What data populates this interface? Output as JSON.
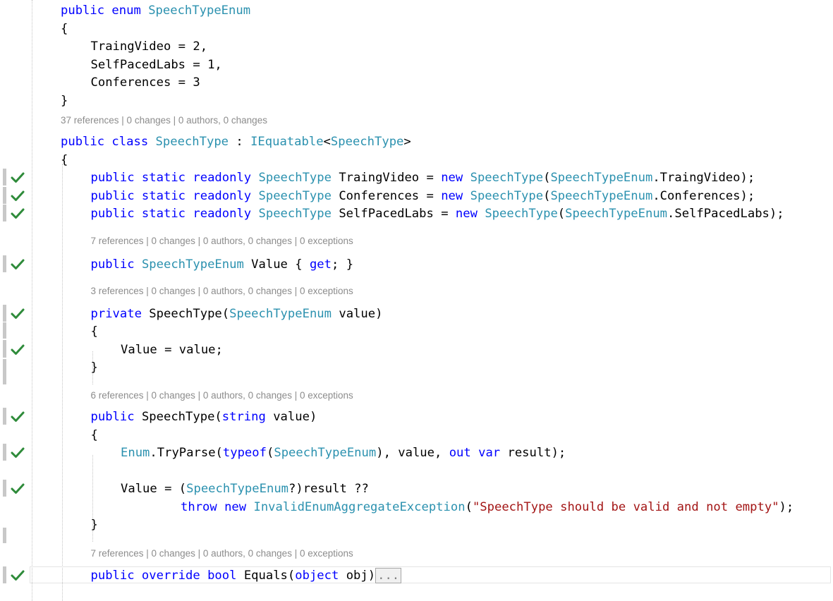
{
  "colors": {
    "keyword": "#0000ff",
    "type": "#2b91af",
    "string": "#a31515",
    "text": "#000000",
    "codelens": "#8c8c8c",
    "check": "#2e8b3a",
    "gutter_bar": "#c8c8c8"
  },
  "editor": {
    "lines": [
      {
        "kind": "code",
        "row": 0,
        "indent": 0,
        "check": false,
        "tokens": [
          [
            "kw",
            "public enum "
          ],
          [
            "ty",
            "SpeechTypeEnum"
          ]
        ]
      },
      {
        "kind": "code",
        "row": 1,
        "indent": 0,
        "check": false,
        "tokens": [
          [
            "tx",
            "{"
          ]
        ]
      },
      {
        "kind": "code",
        "row": 2,
        "indent": 1,
        "check": false,
        "tokens": [
          [
            "tx",
            "TraingVideo = 2,"
          ]
        ]
      },
      {
        "kind": "code",
        "row": 3,
        "indent": 1,
        "check": false,
        "tokens": [
          [
            "tx",
            "SelfPacedLabs = 1,"
          ]
        ]
      },
      {
        "kind": "code",
        "row": 4,
        "indent": 1,
        "check": false,
        "tokens": [
          [
            "tx",
            "Conferences = 3"
          ]
        ]
      },
      {
        "kind": "code",
        "row": 5,
        "indent": 0,
        "check": false,
        "tokens": [
          [
            "tx",
            "}"
          ]
        ]
      },
      {
        "kind": "lens",
        "row": 6.5,
        "indent": 0,
        "text": "37 references | 0 changes | 0 authors, 0 changes"
      },
      {
        "kind": "code",
        "row": 7.3,
        "indent": 0,
        "check": false,
        "tokens": [
          [
            "kw",
            "public class "
          ],
          [
            "ty",
            "SpeechType"
          ],
          [
            "tx",
            " : "
          ],
          [
            "ty",
            "IEquatable"
          ],
          [
            "tx",
            "<"
          ],
          [
            "ty",
            "SpeechType"
          ],
          [
            "tx",
            ">"
          ]
        ]
      },
      {
        "kind": "code",
        "row": 8.3,
        "indent": 0,
        "check": false,
        "tokens": [
          [
            "tx",
            "{"
          ]
        ]
      },
      {
        "kind": "code",
        "row": 9.3,
        "indent": 1,
        "check": true,
        "tokens": [
          [
            "kw",
            "public static readonly "
          ],
          [
            "ty",
            "SpeechType"
          ],
          [
            "tx",
            " TraingVideo = "
          ],
          [
            "kw",
            "new "
          ],
          [
            "ty",
            "SpeechType"
          ],
          [
            "tx",
            "("
          ],
          [
            "ty",
            "SpeechTypeEnum"
          ],
          [
            "tx",
            ".TraingVideo);"
          ]
        ]
      },
      {
        "kind": "code",
        "row": 10.3,
        "indent": 1,
        "check": true,
        "tokens": [
          [
            "kw",
            "public static readonly "
          ],
          [
            "ty",
            "SpeechType"
          ],
          [
            "tx",
            " Conferences = "
          ],
          [
            "kw",
            "new "
          ],
          [
            "ty",
            "SpeechType"
          ],
          [
            "tx",
            "("
          ],
          [
            "ty",
            "SpeechTypeEnum"
          ],
          [
            "tx",
            ".Conferences);"
          ]
        ]
      },
      {
        "kind": "code",
        "row": 11.3,
        "indent": 1,
        "check": true,
        "tokens": [
          [
            "kw",
            "public static readonly "
          ],
          [
            "ty",
            "SpeechType"
          ],
          [
            "tx",
            " SelfPacedLabs = "
          ],
          [
            "kw",
            "new "
          ],
          [
            "ty",
            "SpeechType"
          ],
          [
            "tx",
            "("
          ],
          [
            "ty",
            "SpeechTypeEnum"
          ],
          [
            "tx",
            ".SelfPacedLabs);"
          ]
        ]
      },
      {
        "kind": "lens",
        "row": 13.2,
        "indent": 1,
        "text": "7 references | 0 changes | 0 authors, 0 changes | 0 exceptions"
      },
      {
        "kind": "code",
        "row": 14.1,
        "indent": 1,
        "check": true,
        "tokens": [
          [
            "kw",
            "public "
          ],
          [
            "ty",
            "SpeechTypeEnum"
          ],
          [
            "tx",
            " Value { "
          ],
          [
            "kw",
            "get"
          ],
          [
            "tx",
            "; }"
          ]
        ]
      },
      {
        "kind": "lens",
        "row": 16.0,
        "indent": 1,
        "text": "3 references | 0 changes | 0 authors, 0 changes | 0 exceptions"
      },
      {
        "kind": "code",
        "row": 16.85,
        "indent": 1,
        "check": true,
        "tokens": [
          [
            "kw",
            "private "
          ],
          [
            "tx",
            "SpeechType("
          ],
          [
            "ty",
            "SpeechTypeEnum"
          ],
          [
            "tx",
            " value)"
          ]
        ]
      },
      {
        "kind": "code",
        "row": 17.85,
        "indent": 1,
        "check": false,
        "tokens": [
          [
            "tx",
            "{"
          ]
        ]
      },
      {
        "kind": "code",
        "row": 18.85,
        "indent": 2,
        "check": true,
        "tokens": [
          [
            "tx",
            "Value = value;"
          ]
        ]
      },
      {
        "kind": "code",
        "row": 19.85,
        "indent": 1,
        "check": false,
        "tokens": [
          [
            "tx",
            "}"
          ]
        ]
      },
      {
        "kind": "lens",
        "row": 21.8,
        "indent": 1,
        "text": "6 references | 0 changes | 0 authors, 0 changes | 0 exceptions"
      },
      {
        "kind": "code",
        "row": 22.6,
        "indent": 1,
        "check": true,
        "tokens": [
          [
            "kw",
            "public "
          ],
          [
            "tx",
            "SpeechType("
          ],
          [
            "kw",
            "string"
          ],
          [
            "tx",
            " value)"
          ]
        ]
      },
      {
        "kind": "code",
        "row": 23.6,
        "indent": 1,
        "check": false,
        "tokens": [
          [
            "tx",
            "{"
          ]
        ]
      },
      {
        "kind": "code",
        "row": 24.6,
        "indent": 2,
        "check": true,
        "tokens": [
          [
            "ty",
            "Enum"
          ],
          [
            "tx",
            ".TryParse("
          ],
          [
            "kw",
            "typeof"
          ],
          [
            "tx",
            "("
          ],
          [
            "ty",
            "SpeechTypeEnum"
          ],
          [
            "tx",
            "), value, "
          ],
          [
            "kw",
            "out var"
          ],
          [
            "tx",
            " result);"
          ]
        ]
      },
      {
        "kind": "code",
        "row": 26.6,
        "indent": 2,
        "check": true,
        "tokens": [
          [
            "tx",
            "Value = ("
          ],
          [
            "ty",
            "SpeechTypeEnum"
          ],
          [
            "tx",
            "?)result ??"
          ]
        ]
      },
      {
        "kind": "code",
        "row": 27.6,
        "indent": 4,
        "check": false,
        "tokens": [
          [
            "kw",
            "throw new "
          ],
          [
            "ty",
            "InvalidEnumAggregateException"
          ],
          [
            "tx",
            "("
          ],
          [
            "st",
            "\"SpeechType should be valid and not empty\""
          ],
          [
            "tx",
            ");"
          ]
        ]
      },
      {
        "kind": "code",
        "row": 28.6,
        "indent": 1,
        "check": false,
        "tokens": [
          [
            "tx",
            "}"
          ]
        ]
      },
      {
        "kind": "lens",
        "row": 30.6,
        "indent": 1,
        "text": "7 references | 0 changes | 0 authors, 0 changes | 0 exceptions"
      },
      {
        "kind": "code",
        "row": 31.4,
        "indent": 1,
        "check": true,
        "current": true,
        "tokens": [
          [
            "kw",
            "public override bool "
          ],
          [
            "tx",
            "Equals("
          ],
          [
            "kw",
            "object"
          ],
          [
            "tx",
            " obj)"
          ]
        ],
        "collapsed": "..."
      }
    ]
  }
}
